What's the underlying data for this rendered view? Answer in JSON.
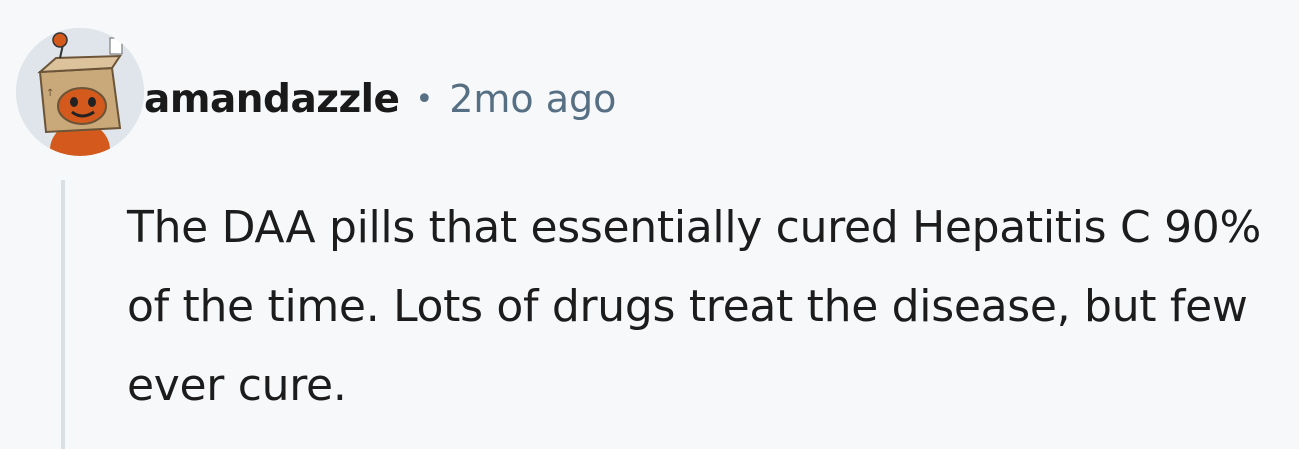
{
  "comment": {
    "avatar_icon": "snoo-avatar-icon",
    "username": "amandazzle",
    "separator": "•",
    "timestamp": "2mo ago",
    "body": "The DAA pills that essentially cured Hepatitis C 90% of the time. Lots of drugs treat the disease, but few ever cure."
  },
  "colors": {
    "background": "#f6f8fa",
    "username": "#1a1a1b",
    "meta": "#576f83",
    "thread_line": "#d9dfe4",
    "avatar_body": "#d35a1c"
  }
}
